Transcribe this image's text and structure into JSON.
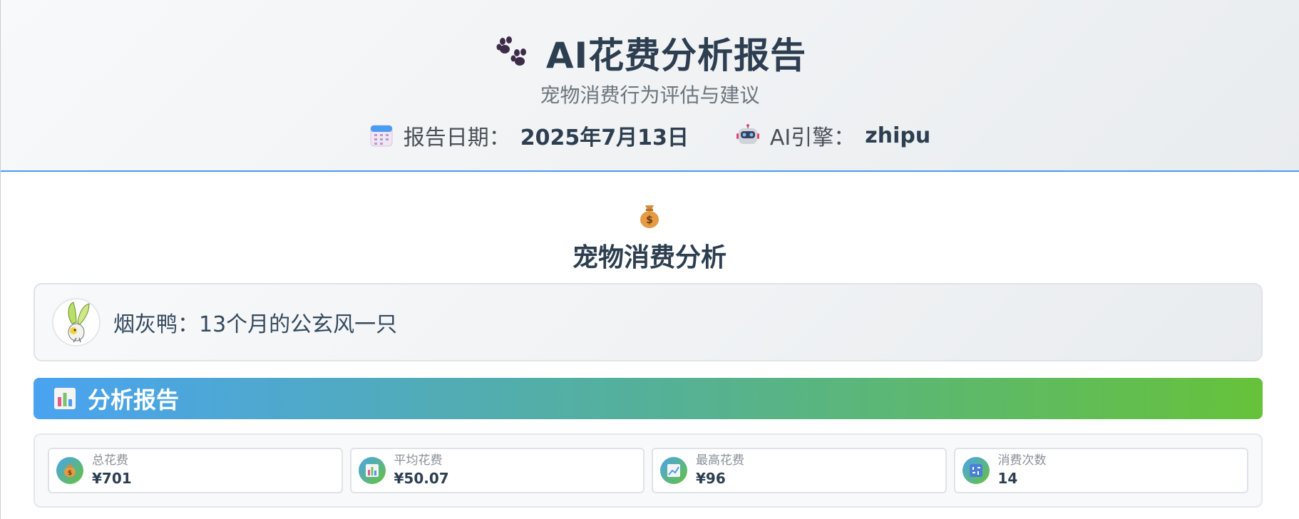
{
  "header": {
    "title": "AI花费分析报告",
    "subtitle": "宠物消费行为评估与建议",
    "date_label": "报告日期：",
    "date_value": "2025年7月13日",
    "engine_label": "AI引擎：",
    "engine_value": "zhipu",
    "icons": [
      "paw-icon",
      "calendar-icon",
      "robot-icon"
    ]
  },
  "section": {
    "title": "宠物消费分析",
    "icon": "money-bag-icon"
  },
  "pet": {
    "label": "烟灰鸭：",
    "description": "13个月的公玄风一只",
    "avatar": "bird-avatar"
  },
  "analysis": {
    "title": "分析报告",
    "icon": "bar-chart-icon"
  },
  "stats": [
    {
      "label": "总花费",
      "value": "¥701",
      "icon": "money-bag-icon"
    },
    {
      "label": "平均花费",
      "value": "¥50.07",
      "icon": "bar-chart-icon"
    },
    {
      "label": "最高花费",
      "value": "¥96",
      "icon": "trend-up-icon"
    },
    {
      "label": "消费次数",
      "value": "14",
      "icon": "numbers-icon"
    }
  ],
  "colors": {
    "accent": "#4a9cf0",
    "gradient_start": "#4aa3f0",
    "gradient_end": "#66c23a",
    "title_text": "#2c3e50"
  }
}
